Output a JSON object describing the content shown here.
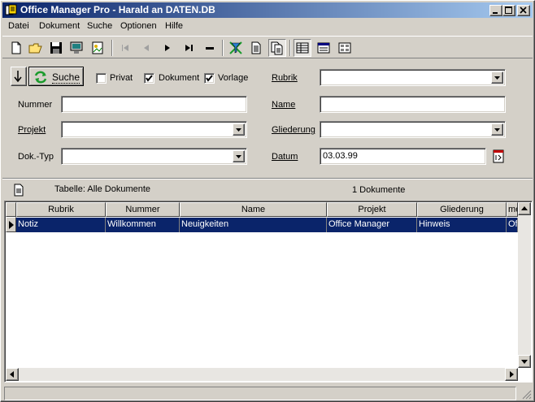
{
  "window": {
    "title": "Office Manager Pro - Harald an DATEN.DB"
  },
  "menu": {
    "items": [
      {
        "label": "Datei"
      },
      {
        "label": "Dokument"
      },
      {
        "label": "Suche"
      },
      {
        "label": "Optionen"
      },
      {
        "label": "Hilfe"
      }
    ]
  },
  "search": {
    "button_label": "Suche",
    "privat_label": "Privat",
    "privat_checked": false,
    "dokument_label": "Dokument",
    "dokument_checked": true,
    "vorlage_label": "Vorlage",
    "vorlage_checked": true,
    "fields": {
      "nummer_label": "Nummer",
      "nummer_value": "",
      "projekt_label": "Projekt",
      "projekt_value": "",
      "doktyp_label": "Dok.-Typ",
      "doktyp_value": "",
      "rubrik_label": "Rubrik",
      "rubrik_value": "",
      "name_label": "Name",
      "name_value": "",
      "gliederung_label": "Gliederung",
      "gliederung_value": "",
      "datum_label": "Datum",
      "datum_value": "03.03.99"
    }
  },
  "table_info": {
    "table_label": "Tabelle: Alle Dokumente",
    "count_label": "1 Dokumente"
  },
  "grid": {
    "columns": [
      "Rubrik",
      "Nummer",
      "Name",
      "Projekt",
      "Gliederung",
      "me"
    ],
    "rows": [
      [
        "Notiz",
        "Willkommen",
        "Neuigkeiten",
        "Office Manager",
        "Hinweis",
        "Of"
      ]
    ],
    "selected_row": 0,
    "selection_color": "#0a246a"
  },
  "colors": {
    "face": "#d4d0c8",
    "title_start": "#0a246a",
    "title_end": "#a6caf0",
    "accent_green": "#1a9b2c"
  }
}
